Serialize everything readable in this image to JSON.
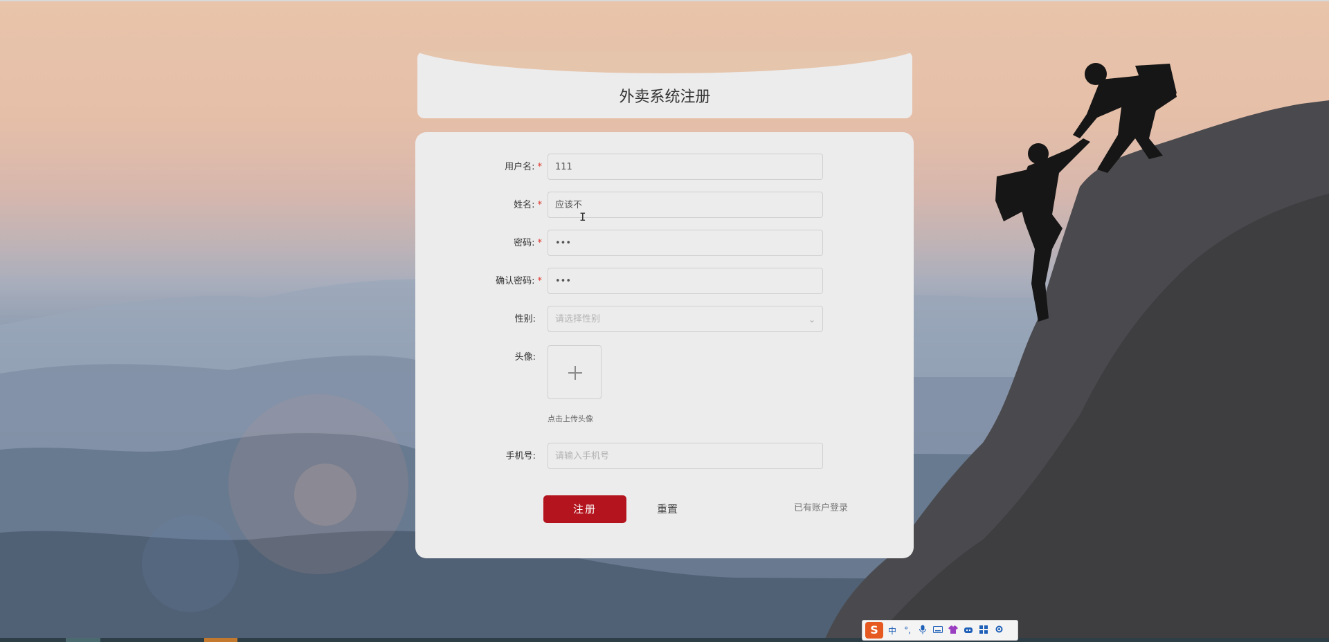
{
  "title": "外卖系统注册",
  "form": {
    "username": {
      "label": "用户名:",
      "required": true,
      "value": "111"
    },
    "name": {
      "label": "姓名:",
      "required": true,
      "value": "应该不"
    },
    "password": {
      "label": "密码:",
      "required": true,
      "value": "•••"
    },
    "confirm_password": {
      "label": "确认密码:",
      "required": true,
      "value": "•••"
    },
    "gender": {
      "label": "性别:",
      "placeholder": "请选择性别"
    },
    "avatar": {
      "label": "头像:",
      "hint": "点击上传头像"
    },
    "phone": {
      "label": "手机号:",
      "placeholder": "请输入手机号"
    },
    "required_mark": "*"
  },
  "actions": {
    "submit": "注册",
    "reset": "重置",
    "login_link": "已有账户登录"
  },
  "ime": {
    "logo": "S",
    "mode": "中",
    "punct": "°,",
    "mic_icon": "mic-icon",
    "keyboard_icon": "keyboard-icon"
  },
  "colors": {
    "primary": "#b3141d",
    "required": "#e0352b",
    "card": "#ececec"
  }
}
